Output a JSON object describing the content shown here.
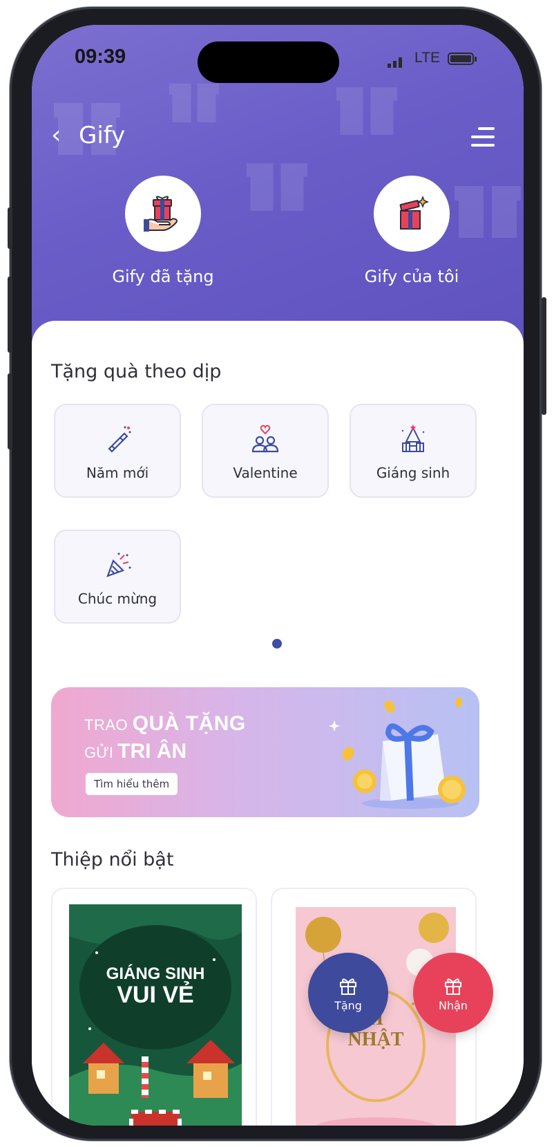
{
  "status_bar": {
    "time": "09:39",
    "network": "LTE"
  },
  "header": {
    "back_icon": "chevron-left-icon",
    "title": "Gify",
    "menu_icon": "hamburger-menu-icon"
  },
  "top_actions": [
    {
      "label": "Gify đã tặng",
      "icon": "gift-in-hand-icon"
    },
    {
      "label": "Gify của tôi",
      "icon": "gift-box-sparkle-icon"
    }
  ],
  "occasions": {
    "title": "Tặng quà theo dịp",
    "items": [
      {
        "label": "Năm mới",
        "icon": "champagne-icon"
      },
      {
        "label": "Valentine",
        "icon": "couple-heart-icon"
      },
      {
        "label": "Giáng sinh",
        "icon": "christmas-tree-icon"
      },
      {
        "label": "Chúc mừng",
        "icon": "party-popper-icon"
      }
    ],
    "page_indicator": {
      "current": 1,
      "total": 1
    }
  },
  "banner": {
    "line1_prefix": "TRAO ",
    "line1_bold": "QUÀ TẶNG",
    "line2_prefix": "GỬI ",
    "line2_bold": "TRI ÂN",
    "cta": "Tìm hiểu thêm"
  },
  "featured": {
    "title": "Thiệp nổi bật",
    "cards": [
      {
        "text_line1": "GIÁNG SINH",
        "text_line2": "VUI VẺ"
      },
      {
        "text_line1": "H",
        "text_line2": "NHẬT"
      }
    ]
  },
  "fabs": [
    {
      "label": "Tặng",
      "icon": "gift-icon",
      "color": "#3e4a9c"
    },
    {
      "label": "Nhận",
      "icon": "gift-icon",
      "color": "#e8425b"
    }
  ],
  "colors": {
    "primary": "#6a5dc8",
    "navy": "#3d4ea3",
    "accent_red": "#e8425b"
  }
}
